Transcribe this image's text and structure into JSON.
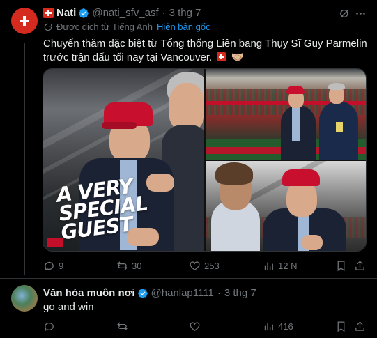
{
  "tweet1": {
    "display_name": "Nati",
    "handle": "@nati_sfv_asf",
    "separator": "·",
    "date": "3 thg 7",
    "translated_note": "Được dịch từ Tiếng Anh",
    "show_original": "Hiện bản gốc",
    "text": "Chuyến thăm đặc biệt từ Tổng thống Liên bang Thụy Sĩ Guy Parmelin trước trận đấu tối nay tại Vancouver.",
    "text_emoji": "🤝🏼",
    "image_overlay_line1": "A VERY",
    "image_overlay_line2": "SPECIAL",
    "image_overlay_line3": "GUEST",
    "stats": {
      "replies": "9",
      "reposts": "30",
      "likes": "253",
      "views": "12 N"
    },
    "accent": "#d52b1e"
  },
  "tweet2": {
    "display_name": "Văn hóa muôn nơi",
    "handle": "@hanlap1111",
    "separator": "·",
    "date": "3 thg 7",
    "text": "go and win",
    "stats": {
      "replies": "",
      "reposts": "",
      "likes": "",
      "views": "416"
    }
  },
  "colors": {
    "link": "#1d9bf0",
    "muted": "#71767b",
    "verified": "#1d9bf0",
    "background": "#000000"
  }
}
